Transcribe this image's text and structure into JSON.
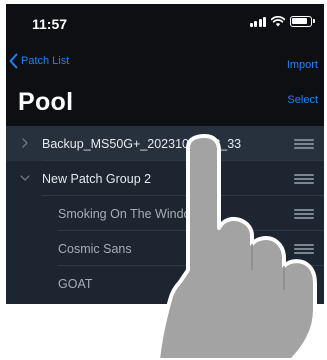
{
  "status_bar": {
    "time": "11:57",
    "icons": [
      "signal-icon",
      "wifi-icon",
      "battery-icon"
    ]
  },
  "nav": {
    "back_label": "Patch List",
    "import_label": "Import",
    "title": "Pool",
    "select_label": "Select"
  },
  "patches": [
    {
      "label": "Backup_MS50G+_20231027 12_33",
      "expanded": false,
      "level": 0
    },
    {
      "label": "New Patch Group 2",
      "expanded": true,
      "level": 0
    },
    {
      "label": "Smoking On The Window",
      "level": 1
    },
    {
      "label": "Cosmic Sans",
      "level": 1
    },
    {
      "label": "GOAT",
      "level": 1
    }
  ],
  "colors": {
    "accent": "#1a84f7",
    "background": "#0d0f12",
    "list_background": "#1d2630",
    "selected_row": "#26313d"
  }
}
